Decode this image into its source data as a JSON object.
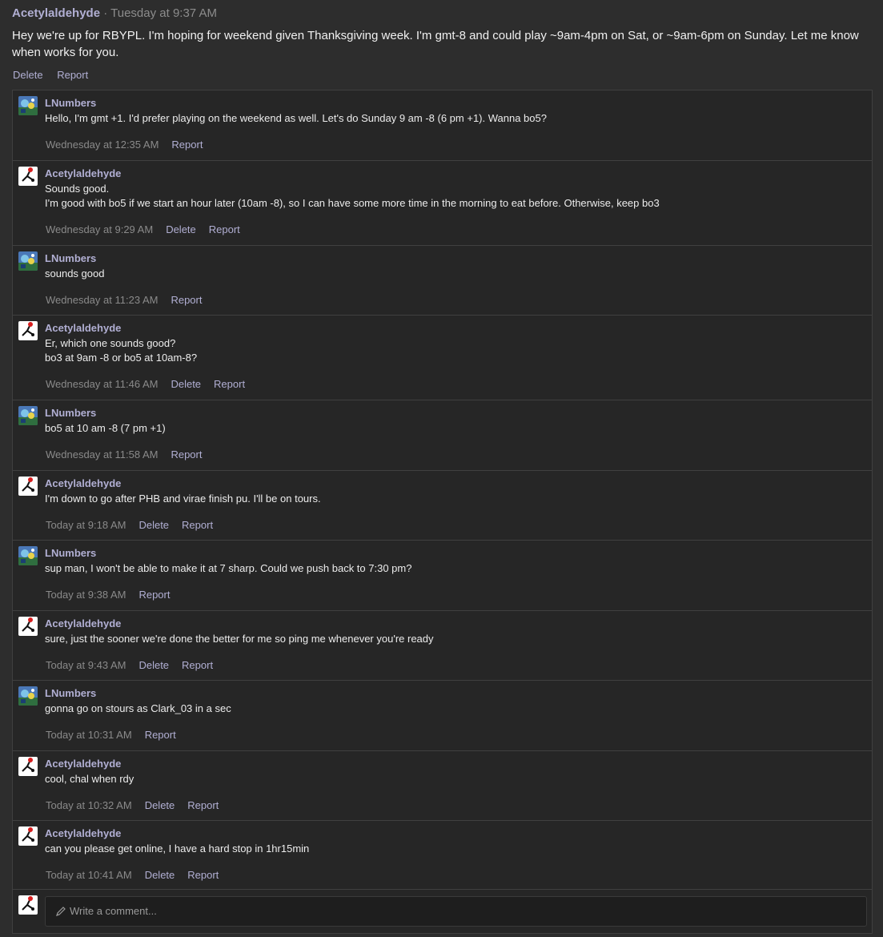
{
  "post": {
    "author": "Acetylaldehyde",
    "separator": "·",
    "time": "Tuesday at 9:37 AM",
    "body": "Hey we're up for RBYPL. I'm hoping for weekend given Thanksgiving week. I'm gmt-8 and could play ~9am-4pm on Sat, or ~9am-6pm on Sunday. Let me know when works for you.",
    "delete_label": "Delete",
    "report_label": "Report"
  },
  "comments": [
    {
      "author": "LNumbers",
      "avatar": "pokemon-scene-avatar",
      "lines": [
        "Hello, I'm gmt +1. I'd prefer playing on the weekend as well. Let's do Sunday 9 am -8 (6 pm +1). Wanna bo5?"
      ],
      "time": "Wednesday at 12:35 AM",
      "actions": [
        "Report"
      ]
    },
    {
      "author": "Acetylaldehyde",
      "avatar": "molecule-avatar",
      "lines": [
        "Sounds good.",
        "I'm good with bo5 if we start an hour later (10am -8), so I can have some more time in the morning to eat before. Otherwise, keep bo3"
      ],
      "time": "Wednesday at 9:29 AM",
      "actions": [
        "Delete",
        "Report"
      ]
    },
    {
      "author": "LNumbers",
      "avatar": "pokemon-scene-avatar",
      "lines": [
        "sounds good"
      ],
      "time": "Wednesday at 11:23 AM",
      "actions": [
        "Report"
      ]
    },
    {
      "author": "Acetylaldehyde",
      "avatar": "molecule-avatar",
      "lines": [
        "Er, which one sounds good?",
        "bo3 at 9am -8 or bo5 at 10am-8?"
      ],
      "time": "Wednesday at 11:46 AM",
      "actions": [
        "Delete",
        "Report"
      ]
    },
    {
      "author": "LNumbers",
      "avatar": "pokemon-scene-avatar",
      "lines": [
        "bo5 at 10 am -8 (7 pm +1)"
      ],
      "time": "Wednesday at 11:58 AM",
      "actions": [
        "Report"
      ]
    },
    {
      "author": "Acetylaldehyde",
      "avatar": "molecule-avatar",
      "lines": [
        "I'm down to go after PHB and virae finish pu. I'll be on tours."
      ],
      "time": "Today at 9:18 AM",
      "actions": [
        "Delete",
        "Report"
      ]
    },
    {
      "author": "LNumbers",
      "avatar": "pokemon-scene-avatar",
      "lines": [
        "sup man, I won't be able to make it at 7 sharp. Could we push back to 7:30 pm?"
      ],
      "time": "Today at 9:38 AM",
      "actions": [
        "Report"
      ]
    },
    {
      "author": "Acetylaldehyde",
      "avatar": "molecule-avatar",
      "lines": [
        "sure, just the sooner we're done the better for me so ping me whenever you're ready"
      ],
      "time": "Today at 9:43 AM",
      "actions": [
        "Delete",
        "Report"
      ]
    },
    {
      "author": "LNumbers",
      "avatar": "pokemon-scene-avatar",
      "lines": [
        "gonna go on stours as Clark_03 in a sec"
      ],
      "time": "Today at 10:31 AM",
      "actions": [
        "Report"
      ]
    },
    {
      "author": "Acetylaldehyde",
      "avatar": "molecule-avatar",
      "lines": [
        "cool, chal when rdy"
      ],
      "time": "Today at 10:32 AM",
      "actions": [
        "Delete",
        "Report"
      ]
    },
    {
      "author": "Acetylaldehyde",
      "avatar": "molecule-avatar",
      "lines": [
        "can you please get online, I have a hard stop in 1hr15min"
      ],
      "time": "Today at 10:41 AM",
      "actions": [
        "Delete",
        "Report"
      ]
    }
  ],
  "compose": {
    "placeholder": "Write a comment...",
    "icon": "pencil-icon"
  },
  "colors": {
    "accent": "#b1afd3",
    "background": "#2d2d2d",
    "panel": "#262626",
    "muted": "#8a8a8a"
  }
}
